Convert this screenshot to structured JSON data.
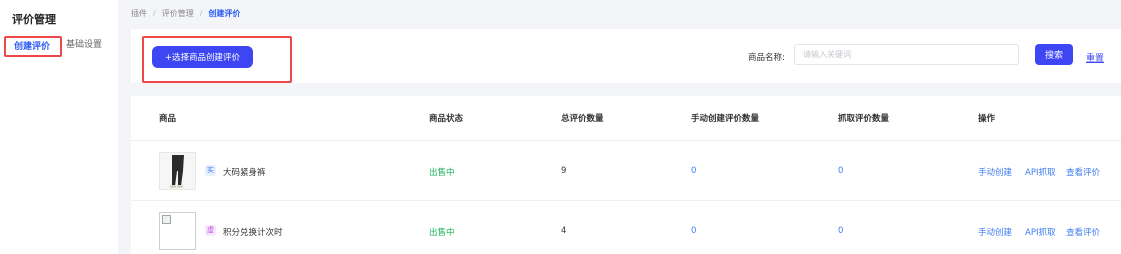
{
  "sidebar": {
    "title": "评价管理",
    "tabs": [
      {
        "label": "创建评价",
        "active": true
      },
      {
        "label": "基础设置",
        "active": false
      }
    ]
  },
  "breadcrumb": [
    "插件",
    "评价管理",
    "创建评价"
  ],
  "toolbar": {
    "create_label": "+选择商品创建评价",
    "search_label": "商品名称:",
    "search_placeholder": "请输入关键词",
    "search_value": "",
    "search_button": "搜索",
    "reset_label": "重置"
  },
  "table": {
    "columns": [
      "商品",
      "商品状态",
      "总评价数量",
      "手动创建评价数量",
      "抓取评价数量",
      "操作"
    ],
    "rows": [
      {
        "tag": "实",
        "name": "大码紧身裤",
        "status": "出售中",
        "total": "9",
        "manual": "0",
        "grab": "0",
        "thumb": "legs-photo"
      },
      {
        "tag": "虚",
        "name": "积分兑换计次时",
        "status": "出售中",
        "total": "4",
        "manual": "0",
        "grab": "0",
        "thumb": "broken-image"
      }
    ],
    "actions": [
      "手动创建",
      "API抓取",
      "查看评价"
    ]
  },
  "colors": {
    "primary": "#3d46f2",
    "link": "#3d7cf2",
    "success": "#19b35a",
    "highlight": "#f04848"
  }
}
